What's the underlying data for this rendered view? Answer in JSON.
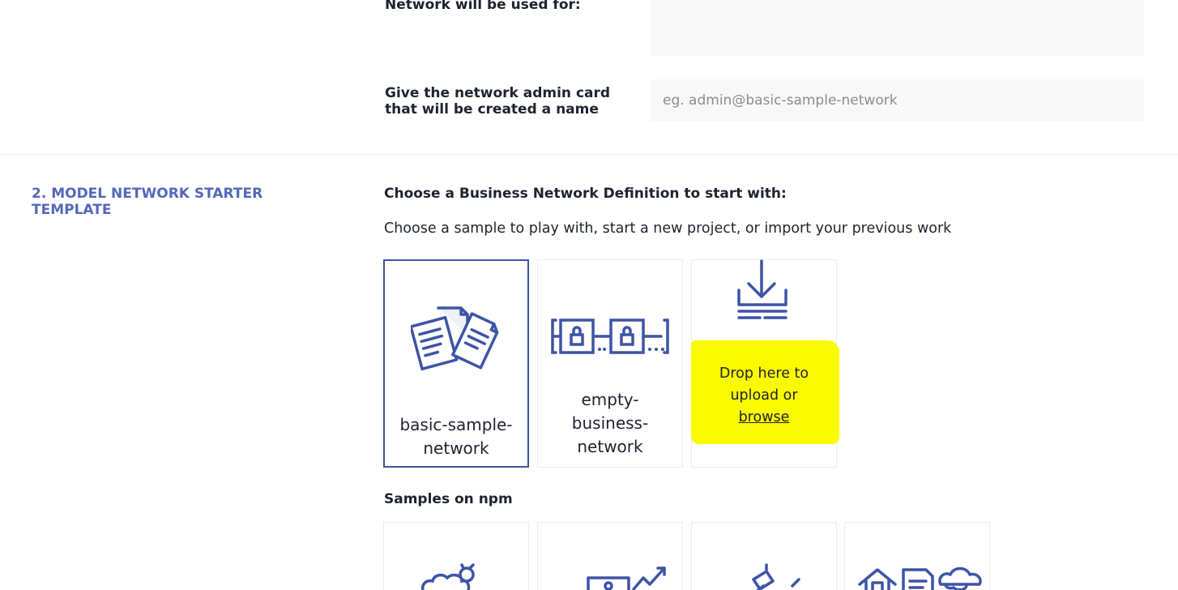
{
  "form": {
    "usage_label": "Network will be used for:",
    "admin_card_label_line1": "Give the network admin card",
    "admin_card_label_line2": "that will be created a name",
    "admin_card_placeholder": "eg. admin@basic-sample-network"
  },
  "section": {
    "title": "2. MODEL NETWORK STARTER TEMPLATE",
    "heading": "Choose a Business Network Definition to start with:",
    "subheading": "Choose a sample to play with, start a new project, or import your previous work"
  },
  "templates": [
    {
      "label_line1": "basic-sample-",
      "label_line2": "network",
      "icon": "documents-icon",
      "selected": true
    },
    {
      "label_line1": "empty-",
      "label_line2": "business-",
      "label_line3": "network",
      "icon": "blocks-chain-icon",
      "selected": false
    }
  ],
  "drop": {
    "line1": "Drop here to",
    "line2": "upload or",
    "browse": "browse",
    "icon": "download-tray-icon"
  },
  "npm": {
    "heading": "Samples on npm",
    "icons": [
      "animal-tracking-icon",
      "trading-chart-icon",
      "auction-gavel-icon",
      "property-docs-icon"
    ]
  },
  "colors": {
    "accent": "#3d54a6",
    "section_title": "#5467b8",
    "highlight": "#fafa00"
  }
}
